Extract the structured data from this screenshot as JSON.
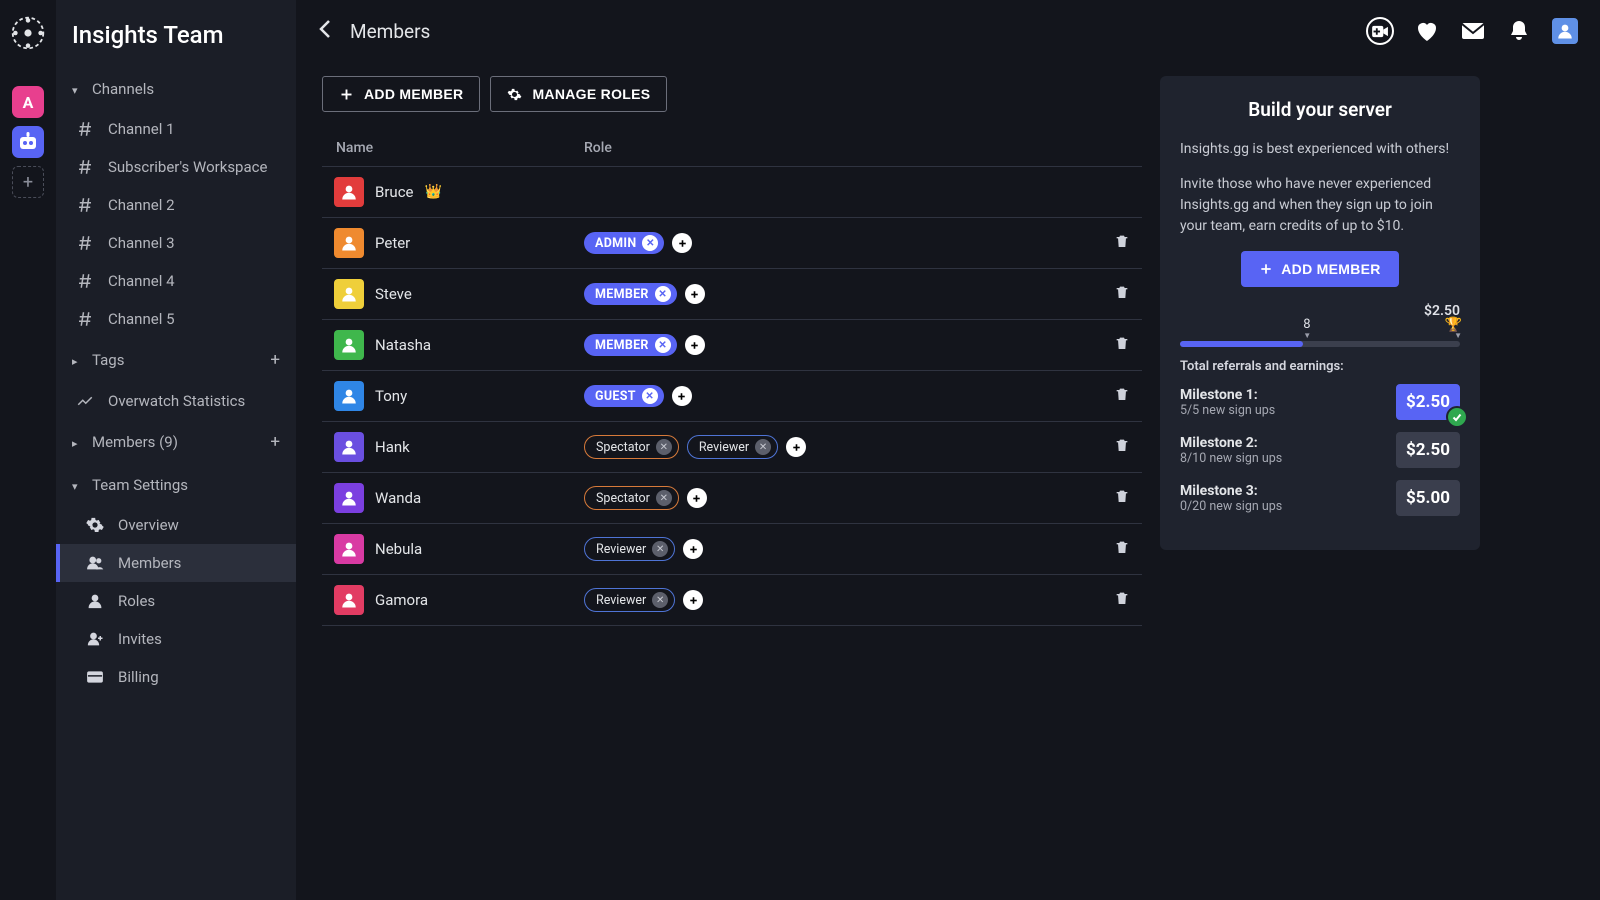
{
  "team_name": "Insights Team",
  "topbar": {
    "crumb": "Members"
  },
  "server_rail": {
    "a_label": "A"
  },
  "sidebar": {
    "channels_label": "Channels",
    "channels": [
      {
        "label": "Channel 1"
      },
      {
        "label": "Subscriber's Workspace"
      },
      {
        "label": "Channel 2"
      },
      {
        "label": "Channel 3"
      },
      {
        "label": "Channel 4"
      },
      {
        "label": "Channel 5"
      }
    ],
    "tags_label": "Tags",
    "stats_label": "Overwatch Statistics",
    "members_label": "Members (9)",
    "team_settings_label": "Team Settings",
    "settings": [
      {
        "label": "Overview"
      },
      {
        "label": "Members"
      },
      {
        "label": "Roles"
      },
      {
        "label": "Invites"
      },
      {
        "label": "Billing"
      }
    ]
  },
  "actions": {
    "add_member": "ADD MEMBER",
    "manage_roles": "MANAGE ROLES"
  },
  "table": {
    "head_name": "Name",
    "head_role": "Role",
    "rows": [
      {
        "name": "Bruce",
        "color": "#e23c3c",
        "owner": true,
        "roles": []
      },
      {
        "name": "Peter",
        "color": "#ef8a2f",
        "owner": false,
        "roles": [
          {
            "label": "ADMIN",
            "kind": "filled"
          }
        ]
      },
      {
        "name": "Steve",
        "color": "#efcf3a",
        "owner": false,
        "roles": [
          {
            "label": "MEMBER",
            "kind": "filled"
          }
        ]
      },
      {
        "name": "Natasha",
        "color": "#3fb74c",
        "owner": false,
        "roles": [
          {
            "label": "MEMBER",
            "kind": "filled"
          }
        ]
      },
      {
        "name": "Tony",
        "color": "#2f86e6",
        "owner": false,
        "roles": [
          {
            "label": "GUEST",
            "kind": "filled"
          }
        ]
      },
      {
        "name": "Hank",
        "color": "#6a4fe0",
        "owner": false,
        "roles": [
          {
            "label": "Spectator",
            "kind": "orange"
          },
          {
            "label": "Reviewer",
            "kind": "blue"
          }
        ]
      },
      {
        "name": "Wanda",
        "color": "#7b3fe0",
        "owner": false,
        "roles": [
          {
            "label": "Spectator",
            "kind": "orange"
          }
        ]
      },
      {
        "name": "Nebula",
        "color": "#d93aa3",
        "owner": false,
        "roles": [
          {
            "label": "Reviewer",
            "kind": "blue"
          }
        ]
      },
      {
        "name": "Gamora",
        "color": "#e23c63",
        "owner": false,
        "roles": [
          {
            "label": "Reviewer",
            "kind": "blue"
          }
        ]
      }
    ]
  },
  "promo": {
    "title": "Build your server",
    "p1": "Insights.gg is best experienced with others!",
    "p2": "Invite those who have never experienced Insights.gg and when they sign up to join your team, earn credits of up to $10.",
    "add_member": "ADD MEMBER",
    "goal_money": "$2.50",
    "mid_tick_label": "8",
    "referrals_title": "Total referrals and earnings:",
    "milestones": [
      {
        "title": "Milestone 1:",
        "sub": "5/5 new sign ups",
        "reward": "$2.50",
        "active": true,
        "check": true
      },
      {
        "title": "Milestone 2:",
        "sub": "8/10 new sign ups",
        "reward": "$2.50",
        "active": false,
        "check": false
      },
      {
        "title": "Milestone 3:",
        "sub": "0/20 new sign ups",
        "reward": "$5.00",
        "active": false,
        "check": false
      }
    ],
    "progress_pct": 44
  }
}
